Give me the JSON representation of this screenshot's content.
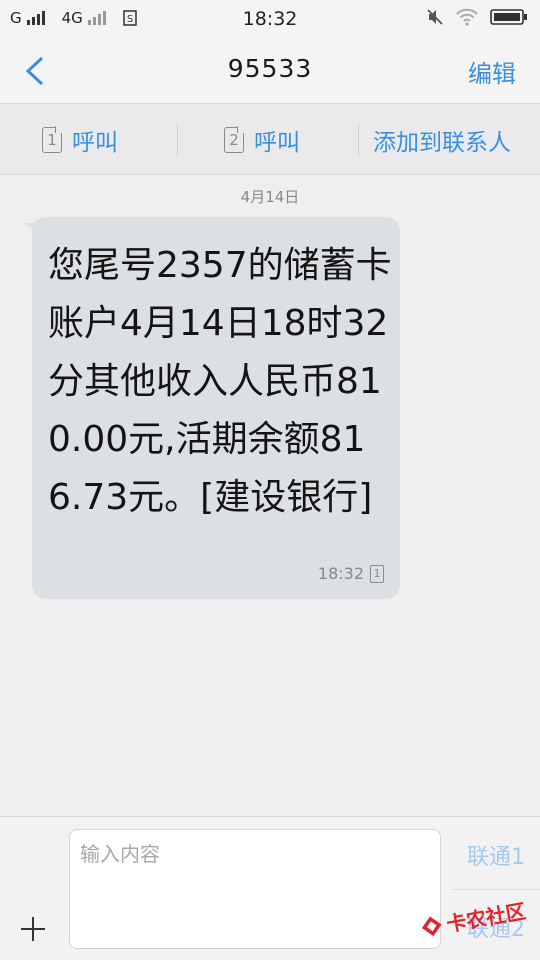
{
  "status_bar": {
    "net_1": "G",
    "net_2": "4G",
    "time": "18:32",
    "icons": [
      "signal-icon",
      "signal-icon",
      "sim-s-icon",
      "mute-icon",
      "wifi-icon",
      "battery-icon"
    ]
  },
  "header": {
    "title": "95533",
    "edit_label": "编辑"
  },
  "actions": {
    "sim1_num": "1",
    "call1_label": "呼叫",
    "sim2_num": "2",
    "call2_label": "呼叫",
    "add_contact_label": "添加到联系人"
  },
  "conversation": {
    "date": "4月14日",
    "message": {
      "text": "您尾号2357的储蓄卡账户4月14日18时32分其他收入人民币810.00元,活期余额816.73元。[建设银行]",
      "time": "18:32",
      "sim": "1"
    }
  },
  "composer": {
    "placeholder": "输入内容",
    "send1_label": "联通1",
    "send2_label": "联通2"
  },
  "watermark": {
    "text": "卡农社区"
  },
  "colors": {
    "accent": "#3a8fe0",
    "bubble": "#dcdfe3",
    "background": "#efeff0",
    "send_disabled": "#a6c8ef"
  }
}
